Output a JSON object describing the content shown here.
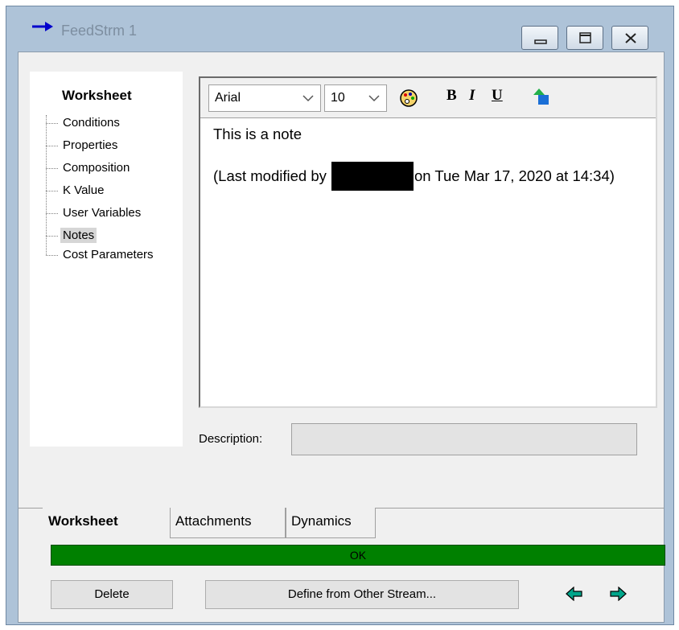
{
  "window": {
    "title": "FeedStrm 1",
    "controls": [
      "minimize",
      "restore",
      "close"
    ]
  },
  "nav": {
    "title": "Worksheet",
    "items": [
      {
        "label": "Conditions",
        "selected": false
      },
      {
        "label": "Properties",
        "selected": false
      },
      {
        "label": "Composition",
        "selected": false
      },
      {
        "label": "K Value",
        "selected": false
      },
      {
        "label": "User Variables",
        "selected": false
      },
      {
        "label": "Notes",
        "selected": true
      },
      {
        "label": "Cost Parameters",
        "selected": false
      }
    ]
  },
  "editor": {
    "font": "Arial",
    "size": "10",
    "format_buttons": {
      "bold": "B",
      "italic": "I",
      "underline": "U"
    },
    "note_line1": "This is a note",
    "modified_prefix": "(Last modified by",
    "modified_suffix": "on Tue Mar 17, 2020 at 14:34)"
  },
  "description": {
    "label": "Description:",
    "value": ""
  },
  "tabs": [
    {
      "label": "Worksheet",
      "active": true
    },
    {
      "label": "Attachments",
      "active": false
    },
    {
      "label": "Dynamics",
      "active": false
    }
  ],
  "status": {
    "text": "OK",
    "color": "#008000"
  },
  "buttons": {
    "delete": "Delete",
    "define": "Define from Other Stream..."
  },
  "icons": {
    "title": "stream-arrow-icon",
    "prev": "arrow-left-icon",
    "next": "arrow-right-icon"
  }
}
